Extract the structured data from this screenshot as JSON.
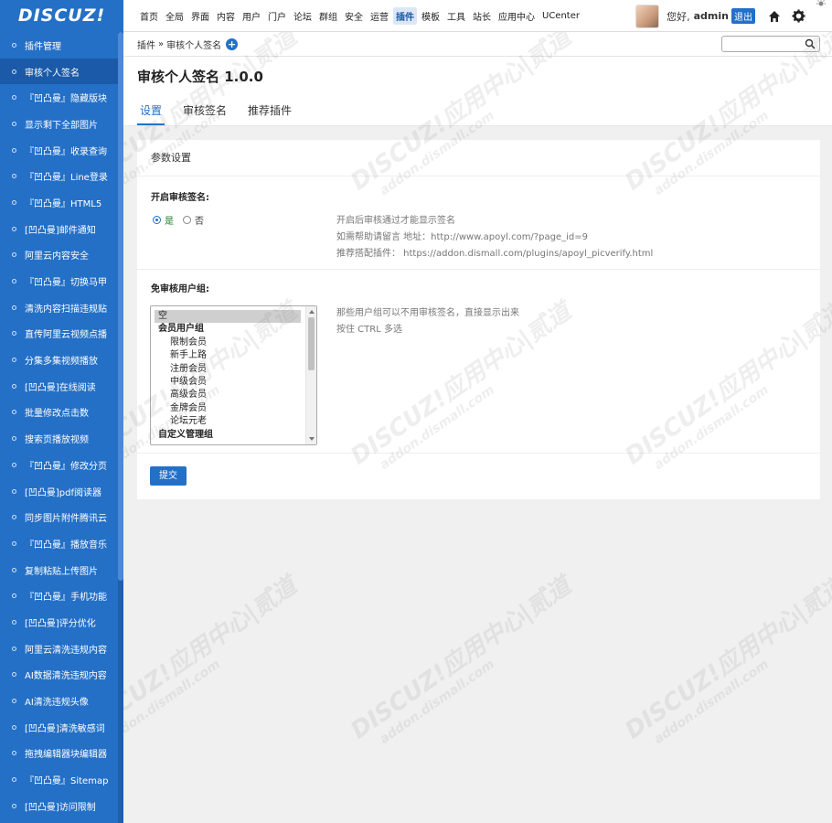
{
  "brand": {
    "logo": "DISCUZ!"
  },
  "topnav": [
    "首页",
    "全局",
    "界面",
    "内容",
    "用户",
    "门户",
    "论坛",
    "群组",
    "安全",
    "运营",
    "插件",
    "模板",
    "工具",
    "站长",
    "应用中心",
    "UCenter"
  ],
  "topnav_active": "插件",
  "user": {
    "greeting": "您好,",
    "name": "admin",
    "logout": "退出"
  },
  "header_icons": [
    "home-icon",
    "gear-icon",
    "moon-icon"
  ],
  "sidebar": [
    "插件管理",
    "审核个人签名",
    "『凹凸曼』隐藏版块",
    "显示剩下全部图片",
    "『凹凸曼』收录查询",
    "『凹凸曼』Line登录",
    "『凹凸曼』HTML5",
    "[凹凸曼]邮件通知",
    "阿里云内容安全",
    "『凹凸曼』切换马甲",
    "清洗内容扫描违规贴",
    "直传阿里云视频点播",
    "分集多集视频播放",
    "[凹凸曼]在线阅读",
    "批量修改点击数",
    "搜索页播放视频",
    "『凹凸曼』修改分页",
    "[凹凸曼]pdf阅读器",
    "同步图片附件腾讯云",
    "『凹凸曼』播放音乐",
    "复制粘贴上传图片",
    "『凹凸曼』手机功能",
    "[凹凸曼]评分优化",
    "阿里云清洗违规内容",
    "AI数据清洗违规内容",
    "AI清洗违规头像",
    "[凹凸曼]清洗敏感词",
    "拖拽编辑器块编辑器",
    "『凹凸曼』Sitemap",
    "[凹凸曼]访问限制"
  ],
  "sidebar_active": "审核个人签名",
  "breadcrumb": {
    "parent": "插件",
    "sep": "»",
    "current": "审核个人签名",
    "add": "+"
  },
  "search": {
    "placeholder": ""
  },
  "page": {
    "title": "审核个人签名 1.0.0",
    "tabs": [
      "设置",
      "审核签名",
      "推荐插件"
    ],
    "active_tab": "设置"
  },
  "panel": {
    "title": "参数设置",
    "enable": {
      "label": "开启审核签名:",
      "yes": "是",
      "no": "否",
      "selected": "是",
      "help": [
        "开启后审核通过才能显示签名",
        "如需帮助请留言 地址：http://www.apoyl.com/?page_id=9",
        "推荐搭配插件：  https://addon.dismall.com/plugins/apoyl_picverify.html"
      ]
    },
    "exempt": {
      "label": "免审核用户组:",
      "options": [
        {
          "text": "空",
          "kind": "sel"
        },
        {
          "text": "会员用户组",
          "kind": "grp"
        },
        {
          "text": "限制会员",
          "kind": "sub"
        },
        {
          "text": "新手上路",
          "kind": "sub"
        },
        {
          "text": "注册会员",
          "kind": "sub"
        },
        {
          "text": "中级会员",
          "kind": "sub"
        },
        {
          "text": "高级会员",
          "kind": "sub"
        },
        {
          "text": "金牌会员",
          "kind": "sub"
        },
        {
          "text": "论坛元老",
          "kind": "sub"
        },
        {
          "text": "自定义管理组",
          "kind": "grp"
        }
      ],
      "help": [
        "那些用户组可以不用审核签名，直接显示出来",
        "按住 CTRL 多选"
      ]
    },
    "submit": "提交"
  },
  "watermark": {
    "brand": "DISCUZ!应用中心|贰道",
    "url": "addon.dismall.com"
  },
  "colors": {
    "accent": "#2470c7",
    "sidebar": "#2470c7",
    "background": "#f0f0f0"
  }
}
